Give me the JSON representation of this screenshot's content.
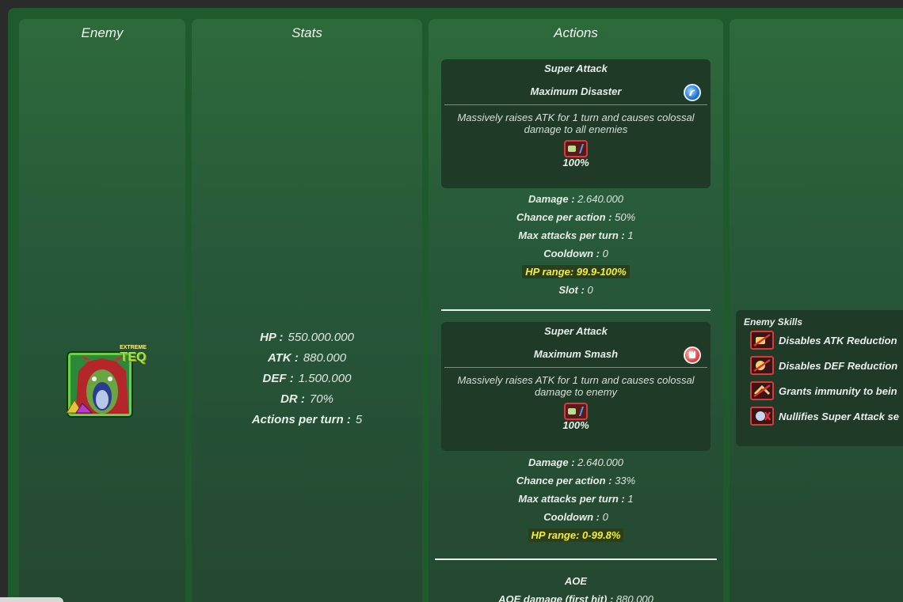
{
  "columns": {
    "enemy": "Enemy",
    "stats": "Stats",
    "actions": "Actions"
  },
  "enemy": {
    "badge_top": "EXTREME",
    "badge_type": "TEQ"
  },
  "stats": [
    {
      "key": "HP :",
      "value": "550.000.000"
    },
    {
      "key": "ATK :",
      "value": "880.000"
    },
    {
      "key": "DEF :",
      "value": "1.500.000"
    },
    {
      "key": "DR :",
      "value": "70%"
    },
    {
      "key": "Actions per turn :",
      "value": "5"
    }
  ],
  "actions": [
    {
      "type": "Super Attack",
      "name": "Maximum Disaster",
      "icon": "blue-type-icon",
      "description": "Massively raises ATK for 1 turn and causes colossal damage to all enemies",
      "effect_pct": "100%",
      "details": [
        {
          "key": "Damage :",
          "value": " 2.640.000"
        },
        {
          "key": "Chance per action :",
          "value": " 50%"
        },
        {
          "key": "Max attacks per turn :",
          "value": " 1"
        },
        {
          "key": "Cooldown :",
          "value": " 0"
        }
      ],
      "hp_range": "HP range: 99.9-100%",
      "slot": {
        "key": "Slot :",
        "value": " 0"
      }
    },
    {
      "type": "Super Attack",
      "name": "Maximum Smash",
      "icon": "red-type-icon",
      "description": "Massively raises ATK for 1 turn and causes colossal damage to enemy",
      "effect_pct": "100%",
      "details": [
        {
          "key": "Damage :",
          "value": " 2.640.000"
        },
        {
          "key": "Chance per action :",
          "value": " 33%"
        },
        {
          "key": "Max attacks per turn :",
          "value": " 1"
        },
        {
          "key": "Cooldown :",
          "value": " 0"
        }
      ],
      "hp_range": "HP range: 0-99.8%"
    }
  ],
  "aoe": {
    "title": "AOE",
    "first_hit_label": "AOE damage (first hit) :",
    "first_hit_value": " 880.000"
  },
  "skills": {
    "title": "Enemy Skills",
    "items": [
      "Disables ATK Reduction",
      "Disables DEF Reduction",
      "Grants immunity to bein",
      "Nullifies Super Attack se"
    ]
  },
  "colors": {
    "frame": "#1f5a2c",
    "card": "#1f3b27",
    "highlight_text": "#f5f02e",
    "icon_border": "#d73b3b"
  }
}
